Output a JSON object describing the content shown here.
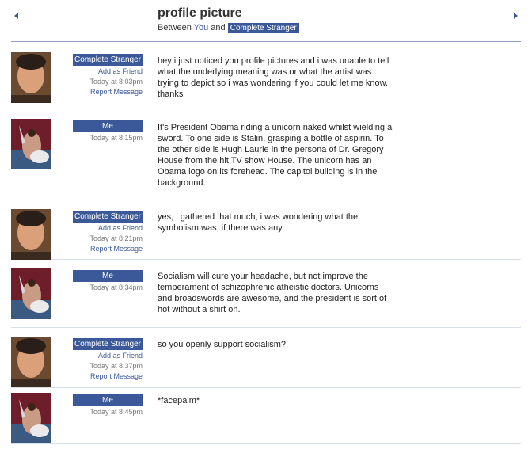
{
  "header": {
    "title": "profile picture",
    "between": "Between",
    "you": "You",
    "and": "and",
    "stranger": "Complete Stranger"
  },
  "messages": [
    {
      "sender": "Complete Stranger",
      "add_friend": "Add as Friend",
      "time": "Today at 8:03pm",
      "report": "Report Message",
      "text": "hey i just noticed you profile pictures and i was unable to tell what the underlying meaning was or what the artist was trying to depict so i was wondering if you could let me know. thanks"
    },
    {
      "sender": "Me",
      "time": "Today at 8:15pm",
      "text": "It's President Obama riding a unicorn naked whilst wielding a sword. To one side is Stalin, grasping a bottle of aspirin. To the other side is Hugh Laurie in the persona of Dr. Gregory House from the hit TV show House. The unicorn has an Obama logo on its forehead. The capitol building is in the background."
    },
    {
      "sender": "Complete Stranger",
      "add_friend": "Add as Friend",
      "time": "Today at 8:21pm",
      "report": "Report Message",
      "text": "yes, i gathered that much, i was wondering what the symbolism was, if there was any"
    },
    {
      "sender": "Me",
      "time": "Today at 8:34pm",
      "text": "Socialism will cure your headache, but not improve the temperament of schizophrenic atheistic doctors. Unicorns and broadswords are awesome, and the president is sort of hot without a shirt on."
    },
    {
      "sender": "Complete Stranger",
      "add_friend": "Add as Friend",
      "time": "Today at 8:37pm",
      "report": "Report Message",
      "text": "so you openly support socialism?"
    },
    {
      "sender": "Me",
      "time": "Today at 8:45pm",
      "text": "*facepalm*"
    }
  ]
}
